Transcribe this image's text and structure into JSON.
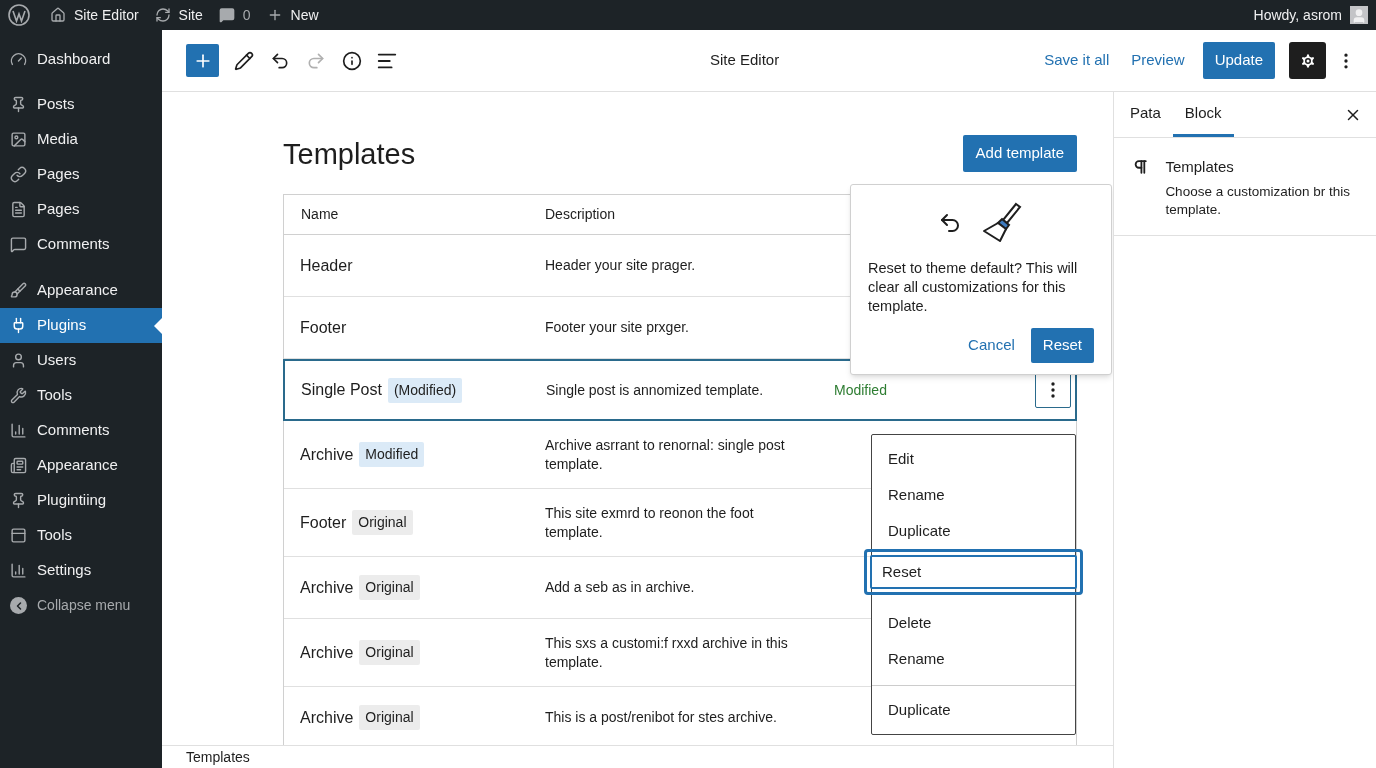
{
  "admin_bar": {
    "site_editor": "Site Editor",
    "site": "Site",
    "comments_count": "0",
    "new": "New",
    "howdy": "Howdy, asrom"
  },
  "sidebar": {
    "groups": [
      [
        {
          "label": "Dashboard",
          "selected": false
        }
      ],
      [
        {
          "label": "Posts",
          "selected": false
        },
        {
          "label": "Media",
          "selected": false
        },
        {
          "label": "Pages",
          "selected": false
        },
        {
          "label": "Pages",
          "selected": false
        },
        {
          "label": "Comments",
          "selected": false
        }
      ],
      [
        {
          "label": "Appearance",
          "selected": false
        },
        {
          "label": "Plugins",
          "selected": true
        },
        {
          "label": "Users",
          "selected": false
        },
        {
          "label": "Tools",
          "selected": false
        },
        {
          "label": "Comments",
          "selected": false
        },
        {
          "label": "Appearance",
          "selected": false
        },
        {
          "label": "Plugintiing",
          "selected": false
        },
        {
          "label": "Tools",
          "selected": false
        },
        {
          "label": "Settings",
          "selected": false
        }
      ]
    ],
    "collapse": "Collapse menu"
  },
  "toolbar": {
    "title": "Site Editor",
    "save_all": "Save it all",
    "preview": "Preview",
    "update": "Update"
  },
  "page": {
    "title": "Templates",
    "add_template": "Add template"
  },
  "table": {
    "columns": [
      "Name",
      "Description"
    ],
    "rows": [
      {
        "name": "Header",
        "description": "Header your site prager.",
        "selected": false
      },
      {
        "name": "Footer",
        "description": "Footer your site prxger.",
        "selected": false
      },
      {
        "name": "Single Post",
        "badge": {
          "label": "(Modified)",
          "kind": "modified"
        },
        "description": "Single post is annomized template.",
        "status": "Modified",
        "selected": true
      },
      {
        "name": "Archive",
        "badge": {
          "label": "Modified",
          "kind": "modified"
        },
        "description": "Archive asrrant to renornal: single post template.",
        "selected": false
      },
      {
        "name": "Footer",
        "badge": {
          "label": "Original",
          "kind": "original"
        },
        "description": "This site exmrd to reonon the foot template.",
        "selected": false
      },
      {
        "name": "Archive",
        "badge": {
          "label": "Original",
          "kind": "original"
        },
        "description": "Add a seb as in archive.",
        "selected": false
      },
      {
        "name": "Archive",
        "badge": {
          "label": "Original",
          "kind": "original"
        },
        "description": "This sxs a customi:f rxxd archive in this template.",
        "selected": false
      },
      {
        "name": "Archive",
        "badge": {
          "label": "Original",
          "kind": "original"
        },
        "description": "This is a post/renibot for stes archive.",
        "selected": false
      }
    ]
  },
  "popover": {
    "message": "Reset to theme default? This will clear all customizations for this template.",
    "cancel": "Cancel",
    "reset": "Reset"
  },
  "menu": {
    "groups": [
      [
        {
          "label": "Edit",
          "selected": false
        },
        {
          "label": "Rename",
          "selected": false
        },
        {
          "label": "Duplicate",
          "selected": false
        },
        {
          "label": "Reset",
          "selected": true
        }
      ],
      [
        {
          "label": "Delete",
          "selected": false
        },
        {
          "label": "Rename",
          "selected": false
        }
      ],
      [
        {
          "label": "Duplicate",
          "selected": false
        }
      ]
    ]
  },
  "inspector": {
    "tabs": [
      {
        "label": "Pata",
        "selected": false
      },
      {
        "label": "Block",
        "selected": true
      }
    ],
    "block_title": "Templates",
    "block_description": "Choose a customization br this template."
  },
  "footer": {
    "breadcrumb": "Templates"
  }
}
